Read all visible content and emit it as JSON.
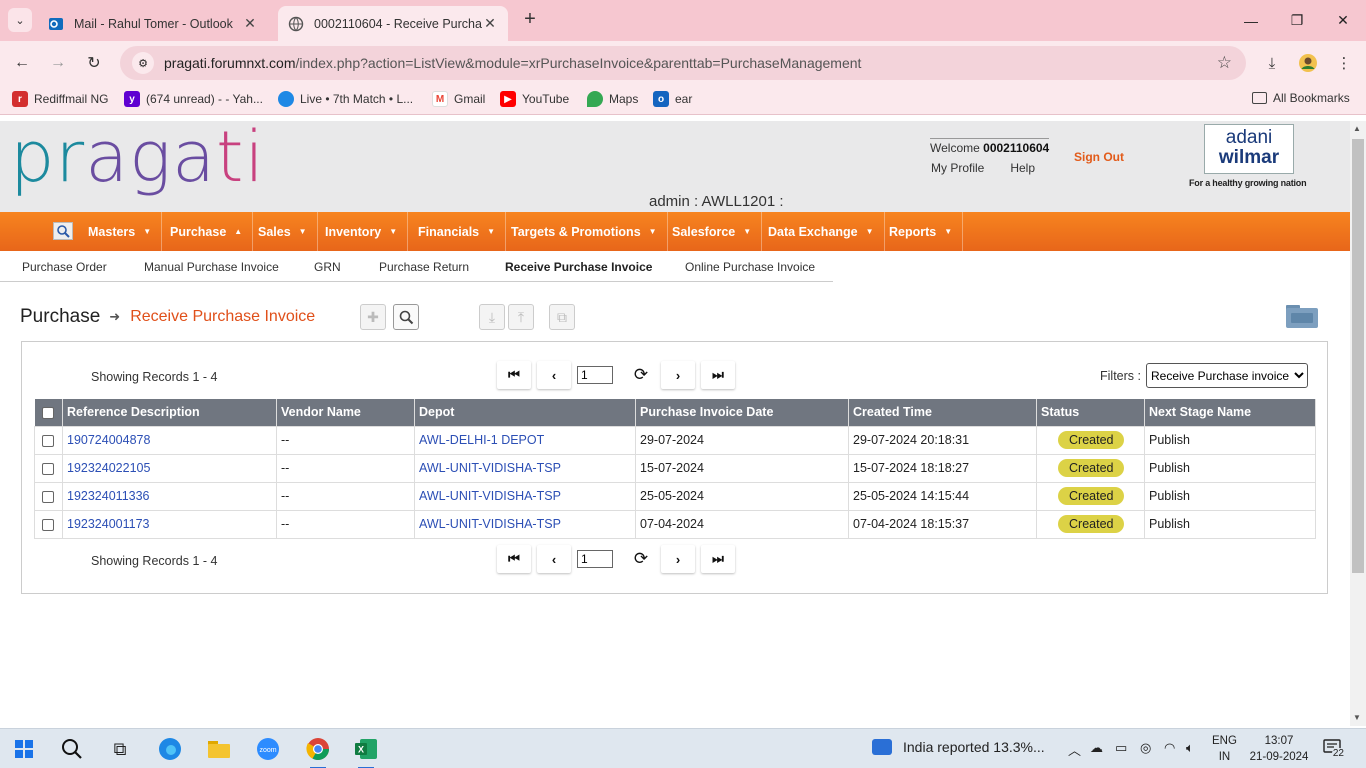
{
  "browser": {
    "tabs": [
      {
        "title": "Mail - Rahul Tomer - Outlook",
        "icon": "outlook-icon"
      },
      {
        "title": "0002110604 - Receive Purchase",
        "icon": "globe-icon"
      }
    ],
    "url_host": "pragati.forumnxt.com",
    "url_path": "/index.php?action=ListView&module=xrPurchaseInvoice&parenttab=PurchaseManagement",
    "bookmarks": [
      {
        "label": "Rediffmail NG",
        "color": "#d32f2f"
      },
      {
        "label": "(674 unread) - - Yah...",
        "color": "#5f01d1"
      },
      {
        "label": "Live • 7th Match • L...",
        "color": "#1e88e5"
      },
      {
        "label": "Gmail",
        "color": "#ea4335"
      },
      {
        "label": "YouTube",
        "color": "#ff0000"
      },
      {
        "label": "Maps",
        "color": "#34a853"
      },
      {
        "label": "ear",
        "color": "#1565c0"
      }
    ],
    "all_bookmarks": "All Bookmarks"
  },
  "header": {
    "logo": {
      "p1": "pr",
      "p2": "aga",
      "p3": "ti"
    },
    "welcome_label": "Welcome",
    "user_id": "0002110604",
    "my_profile": "My Profile",
    "help": "Help",
    "sign_out": "Sign Out",
    "brand_top": "adani",
    "brand_bottom": "wilmar",
    "tagline": "For a healthy growing nation",
    "admin": "admin : AWLL1201 :"
  },
  "nav": {
    "items": [
      "Masters",
      "Purchase",
      "Sales",
      "Inventory",
      "Financials",
      "Targets & Promotions",
      "Salesforce",
      "Data Exchange",
      "Reports"
    ]
  },
  "subnav": {
    "items": [
      "Purchase Order",
      "Manual Purchase Invoice",
      "GRN",
      "Purchase Return",
      "Receive Purchase Invoice",
      "Online Purchase Invoice"
    ],
    "selected": "Receive Purchase Invoice"
  },
  "breadcrumb": {
    "module": "Purchase",
    "current": "Receive Purchase Invoice"
  },
  "list": {
    "showing": "Showing Records 1 - 4",
    "page": "1",
    "filters_label": "Filters :",
    "filter_value": "Receive Purchase invoice",
    "columns": [
      "Reference Description",
      "Vendor Name",
      "Depot",
      "Purchase Invoice Date",
      "Created Time",
      "Status",
      "Next Stage Name"
    ],
    "rows": [
      {
        "ref": "190724004878",
        "vendor": "--",
        "depot": "AWL-DELHI-1 DEPOT",
        "date": "29-07-2024",
        "created": "29-07-2024 20:18:31",
        "status": "Created",
        "next": "Publish"
      },
      {
        "ref": "192324022105",
        "vendor": "--",
        "depot": "AWL-UNIT-VIDISHA-TSP",
        "date": "15-07-2024",
        "created": "15-07-2024 18:18:27",
        "status": "Created",
        "next": "Publish"
      },
      {
        "ref": "192324011336",
        "vendor": "--",
        "depot": "AWL-UNIT-VIDISHA-TSP",
        "date": "25-05-2024",
        "created": "25-05-2024 14:15:44",
        "status": "Created",
        "next": "Publish"
      },
      {
        "ref": "192324001173",
        "vendor": "--",
        "depot": "AWL-UNIT-VIDISHA-TSP",
        "date": "07-04-2024",
        "created": "07-04-2024 18:15:37",
        "status": "Created",
        "next": "Publish"
      }
    ]
  },
  "taskbar": {
    "news": "India reported 13.3%...",
    "lang_top": "ENG",
    "lang_bottom": "IN",
    "time": "13:07",
    "date": "21-09-2024",
    "notifications": "22"
  }
}
